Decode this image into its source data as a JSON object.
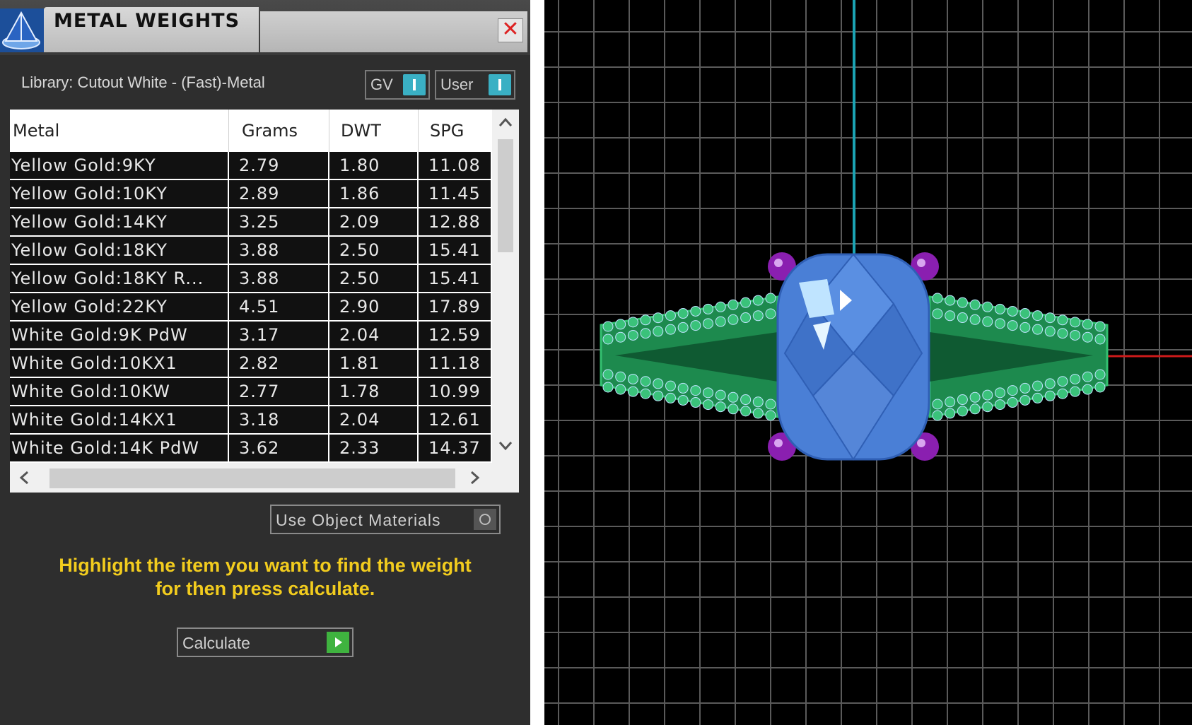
{
  "window": {
    "title": "METAL WEIGHTS",
    "close_glyph": "✕",
    "icon": "pyramid-app-icon"
  },
  "library": {
    "label": "Library: Cutout White - (Fast)-Metal",
    "gv_toggle_label": "GV",
    "user_toggle_label": "User",
    "accent_color": "#3ab0c4"
  },
  "table": {
    "columns": [
      "Metal",
      "Grams",
      "DWT",
      "SPG"
    ],
    "rows": [
      [
        "Yellow Gold:9KY",
        "2.79",
        "1.80",
        "11.08"
      ],
      [
        "Yellow Gold:10KY",
        "2.89",
        "1.86",
        "11.45"
      ],
      [
        "Yellow Gold:14KY",
        "3.25",
        "2.09",
        "12.88"
      ],
      [
        "Yellow Gold:18KY",
        "3.88",
        "2.50",
        "15.41"
      ],
      [
        "Yellow Gold:18KY R...",
        "3.88",
        "2.50",
        "15.41"
      ],
      [
        "Yellow Gold:22KY",
        "4.51",
        "2.90",
        "17.89"
      ],
      [
        "White Gold:9K PdW",
        "3.17",
        "2.04",
        "12.59"
      ],
      [
        "White Gold:10KX1",
        "2.82",
        "1.81",
        "11.18"
      ],
      [
        "White Gold:10KW",
        "2.77",
        "1.78",
        "10.99"
      ],
      [
        "White Gold:14KX1",
        "3.18",
        "2.04",
        "12.61"
      ],
      [
        "White Gold:14K PdW",
        "3.62",
        "2.33",
        "14.37"
      ]
    ],
    "scroll_up": "^",
    "scroll_down": "v",
    "scroll_left": "<",
    "scroll_right": ">"
  },
  "options": {
    "use_object_materials_label": "Use Object Materials"
  },
  "hint": {
    "line1": "Highlight the item you want to find the weight",
    "line2": "for then press calculate.",
    "color": "#f2cc1e"
  },
  "actions": {
    "calculate_label": "Calculate",
    "go_color": "#3fb33f"
  },
  "viewport": {
    "grid_color": "#5a5a5a",
    "axis_y_color": "#1ba3b3",
    "axis_x_color": "#cc1a1a",
    "band_color": "#1d8a4e",
    "stone_color": "#4a7fd6",
    "prong_color": "#8a1fb0"
  }
}
